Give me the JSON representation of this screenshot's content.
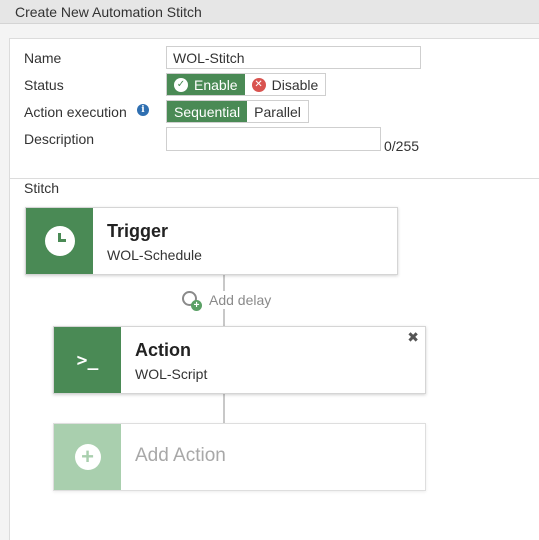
{
  "header": {
    "title": "Create New Automation Stitch"
  },
  "form": {
    "name_label": "Name",
    "name_value": "WOL-Stitch",
    "status_label": "Status",
    "status_options": [
      "Enable",
      "Disable"
    ],
    "status_selected": "Enable",
    "action_exec_label": "Action execution",
    "action_exec_options": [
      "Sequential",
      "Parallel"
    ],
    "action_exec_selected": "Sequential",
    "description_label": "Description",
    "description_value": "",
    "description_counter": "0/255"
  },
  "stitch": {
    "section_label": "Stitch",
    "trigger": {
      "title": "Trigger",
      "name": "WOL-Schedule"
    },
    "add_delay_label": "Add delay",
    "action": {
      "title": "Action",
      "name": "WOL-Script",
      "close_glyph": "✖"
    },
    "add_action_label": "Add Action"
  },
  "icons": {
    "info": "info-icon",
    "trigger": "clock-icon",
    "action": "terminal-icon",
    "add_delay": "clock-plus-icon",
    "add_action": "plus-circle-icon",
    "close": "close-icon"
  },
  "colors": {
    "accent": "#4a8a55",
    "accent_light": "#a9cfae",
    "disable_icon": "#d9534f",
    "info_icon": "#2f6fb1",
    "header_bg": "#e6e6e6"
  }
}
